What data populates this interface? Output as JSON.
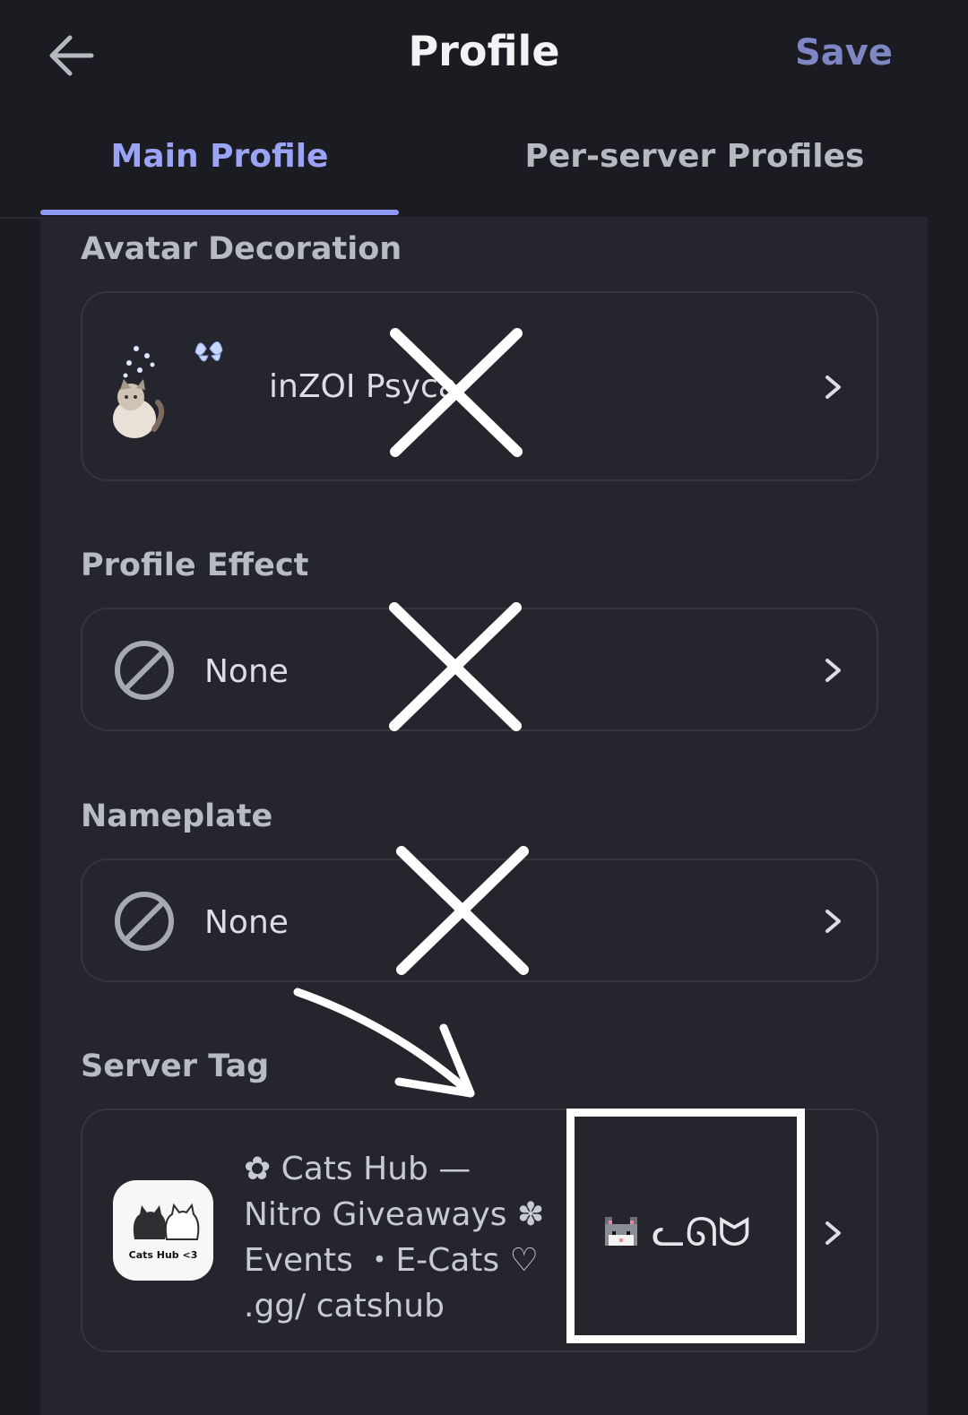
{
  "header": {
    "title": "Profile",
    "save_label": "Save"
  },
  "tabs": [
    {
      "label": "Main Profile",
      "active": true
    },
    {
      "label": "Per-server Profiles",
      "active": false
    }
  ],
  "sections": {
    "avatar_decoration": {
      "label": "Avatar Decoration",
      "value": "inZOI Psyca"
    },
    "profile_effect": {
      "label": "Profile Effect",
      "value": "None"
    },
    "nameplate": {
      "label": "Nameplate",
      "value": "None"
    },
    "server_tag": {
      "label": "Server Tag",
      "server_name": "✿ Cats Hub — Nitro Giveaways ✽ Events ・E-Cats ♡ .gg/ catshub",
      "server_icon_text": "Cats Hub <3",
      "tag_text": "ᓚᘏᗢ"
    }
  },
  "colors": {
    "accent": "#8f99f3",
    "save": "#7f86c4",
    "background": "#1b1c21",
    "panel": "#25262d"
  },
  "icons": {
    "back": "arrow-left-icon",
    "chevron": "chevron-right-icon",
    "none": "prohibited-icon"
  }
}
